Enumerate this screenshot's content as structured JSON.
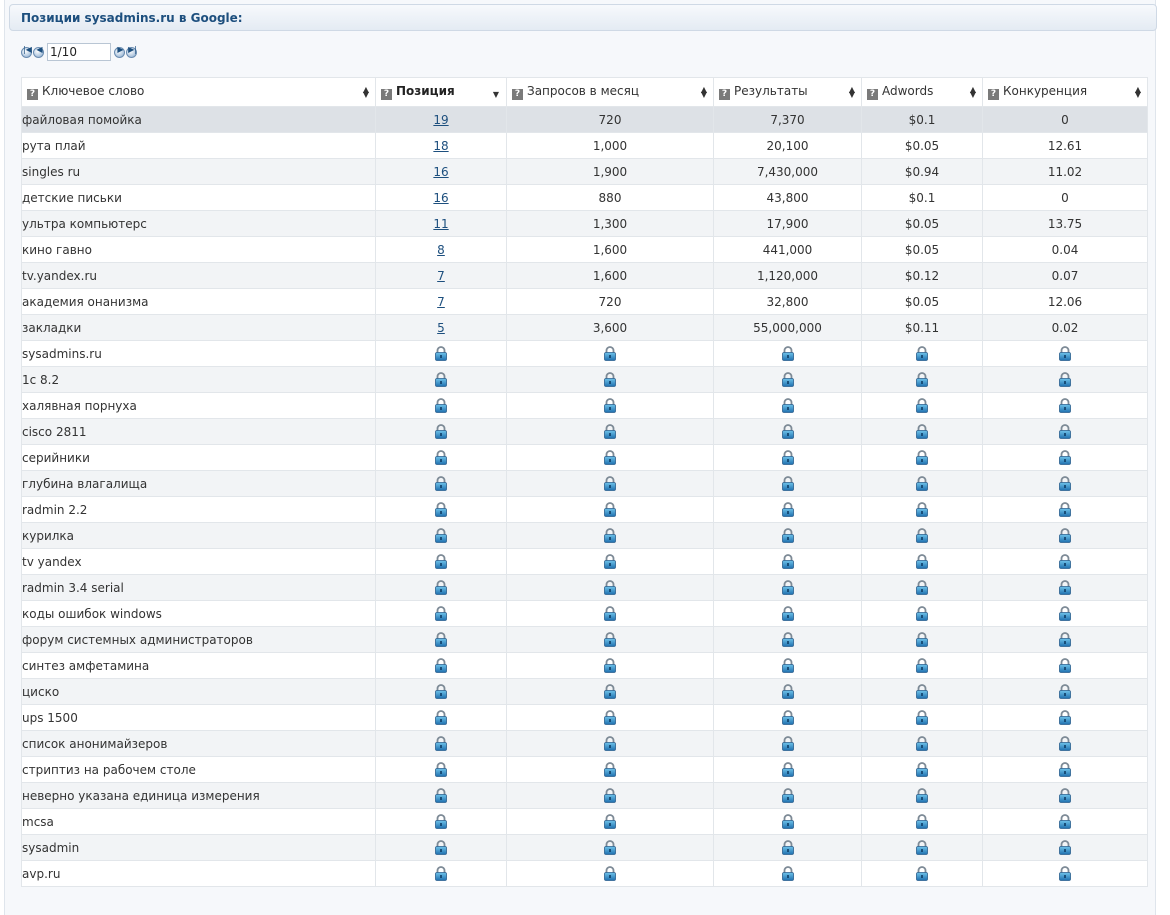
{
  "panel": {
    "title": "Позиции sysadmins.ru в Google:"
  },
  "pager": {
    "first": "|◀",
    "prev": "◀",
    "value": "1/10",
    "next": "▶",
    "last": "▶|"
  },
  "columns": [
    {
      "key": "keyword",
      "label": "Ключевое слово",
      "help": "?"
    },
    {
      "key": "position",
      "label": "Позиция",
      "help": "?"
    },
    {
      "key": "queries",
      "label": "Запросов в месяц",
      "help": "?"
    },
    {
      "key": "results",
      "label": "Результаты",
      "help": "?"
    },
    {
      "key": "adwords",
      "label": "Adwords",
      "help": "?"
    },
    {
      "key": "competition",
      "label": "Конкуренция",
      "help": "?"
    }
  ],
  "rows": [
    {
      "keyword": "файловая помойка",
      "position": "19",
      "queries": "720",
      "results": "7,370",
      "adwords": "$0.1",
      "competition": "0"
    },
    {
      "keyword": "рута плай",
      "position": "18",
      "queries": "1,000",
      "results": "20,100",
      "adwords": "$0.05",
      "competition": "12.61"
    },
    {
      "keyword": "singles ru",
      "position": "16",
      "queries": "1,900",
      "results": "7,430,000",
      "adwords": "$0.94",
      "competition": "11.02"
    },
    {
      "keyword": "детские письки",
      "position": "16",
      "queries": "880",
      "results": "43,800",
      "adwords": "$0.1",
      "competition": "0"
    },
    {
      "keyword": "ультра компьютерс",
      "position": "11",
      "queries": "1,300",
      "results": "17,900",
      "adwords": "$0.05",
      "competition": "13.75"
    },
    {
      "keyword": "кино гавно",
      "position": "8",
      "queries": "1,600",
      "results": "441,000",
      "adwords": "$0.05",
      "competition": "0.04"
    },
    {
      "keyword": "tv.yandex.ru",
      "position": "7",
      "queries": "1,600",
      "results": "1,120,000",
      "adwords": "$0.12",
      "competition": "0.07"
    },
    {
      "keyword": "академия онанизма",
      "position": "7",
      "queries": "720",
      "results": "32,800",
      "adwords": "$0.05",
      "competition": "12.06"
    },
    {
      "keyword": "закладки",
      "position": "5",
      "queries": "3,600",
      "results": "55,000,000",
      "adwords": "$0.11",
      "competition": "0.02"
    },
    {
      "keyword": "sysadmins.ru",
      "locked": true
    },
    {
      "keyword": "1c 8.2",
      "locked": true
    },
    {
      "keyword": "халявная порнуха",
      "locked": true
    },
    {
      "keyword": "cisco 2811",
      "locked": true
    },
    {
      "keyword": "серийники",
      "locked": true
    },
    {
      "keyword": "глубина влагалища",
      "locked": true
    },
    {
      "keyword": "radmin 2.2",
      "locked": true
    },
    {
      "keyword": "курилка",
      "locked": true
    },
    {
      "keyword": "tv yandex",
      "locked": true
    },
    {
      "keyword": "radmin 3.4 serial",
      "locked": true
    },
    {
      "keyword": "коды ошибок windows",
      "locked": true
    },
    {
      "keyword": "форум системных администраторов",
      "locked": true
    },
    {
      "keyword": "синтез амфетамина",
      "locked": true
    },
    {
      "keyword": "циско",
      "locked": true
    },
    {
      "keyword": "ups 1500",
      "locked": true
    },
    {
      "keyword": "список анонимайзеров",
      "locked": true
    },
    {
      "keyword": "стриптиз на рабочем столе",
      "locked": true
    },
    {
      "keyword": "неверно указана единица измерения",
      "locked": true
    },
    {
      "keyword": "mcsa",
      "locked": true
    },
    {
      "keyword": "sysadmin",
      "locked": true
    },
    {
      "keyword": "avp.ru",
      "locked": true
    }
  ],
  "colors": {
    "title": "#1d4f7e",
    "link": "#1d4f7e",
    "highlight_row": "#dde1e6",
    "stripe": "#f2f4f6"
  },
  "icons": {
    "locked_cell": "lock-icon",
    "help": "question-mark-icon",
    "sort": "sort-arrows-icon"
  }
}
